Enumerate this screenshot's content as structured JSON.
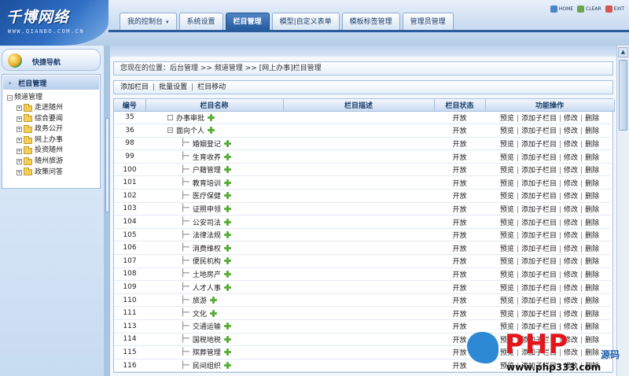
{
  "header": {
    "logo_text": "千博网络",
    "logo_sub": "WWW.QIANBO.COM.CN",
    "tabs": [
      {
        "label": "我的控制台",
        "active": false,
        "has_dropdown": true
      },
      {
        "label": "系统设置",
        "active": false
      },
      {
        "label": "栏目管理",
        "active": true
      },
      {
        "label": "模型|自定义表单",
        "active": false
      },
      {
        "label": "模板标签管理",
        "active": false
      },
      {
        "label": "管理员管理",
        "active": false
      }
    ],
    "quick_buttons": [
      {
        "label": "HOME",
        "icon": "home-icon",
        "color": "#4a86c8"
      },
      {
        "label": "CLEAR",
        "icon": "clear-icon",
        "color": "#6aa84f"
      },
      {
        "label": "EXIT",
        "icon": "exit-icon",
        "color": "#d9534f"
      }
    ]
  },
  "sidebar": {
    "title": "快捷导航",
    "section": "栏目管理",
    "root": "频道管理",
    "items": [
      "走进随州",
      "综合要闻",
      "政务公开",
      "网上办事",
      "投资随州",
      "随州旅游",
      "政策问答"
    ]
  },
  "main": {
    "breadcrumb": "您现在的位置：后台管理 >> 频道管理 >> [网上办事]栏目管理",
    "toolbar": [
      "添加栏目",
      "批量设置",
      "栏目移动"
    ],
    "columns": [
      "编号",
      "栏目名称",
      "栏目描述",
      "栏目状态",
      "功能操作"
    ],
    "ops": [
      "预览",
      "添加子栏目",
      "修改",
      "删除"
    ],
    "rows": [
      {
        "id": "35",
        "name": "办事审批",
        "level": 0,
        "expand": "□",
        "state": "开放"
      },
      {
        "id": "36",
        "name": "面向个人",
        "level": 0,
        "expand": "⊟",
        "state": "开放"
      },
      {
        "id": "98",
        "name": "婚姻登记",
        "level": 1,
        "state": "开放"
      },
      {
        "id": "99",
        "name": "生育收养",
        "level": 1,
        "state": "开放"
      },
      {
        "id": "100",
        "name": "户籍管理",
        "level": 1,
        "state": "开放"
      },
      {
        "id": "101",
        "name": "教育培训",
        "level": 1,
        "state": "开放"
      },
      {
        "id": "102",
        "name": "医疗保健",
        "level": 1,
        "state": "开放"
      },
      {
        "id": "103",
        "name": "证照申领",
        "level": 1,
        "state": "开放"
      },
      {
        "id": "104",
        "name": "公安司法",
        "level": 1,
        "state": "开放"
      },
      {
        "id": "105",
        "name": "法律法规",
        "level": 1,
        "state": "开放"
      },
      {
        "id": "106",
        "name": "消费维权",
        "level": 1,
        "state": "开放"
      },
      {
        "id": "107",
        "name": "便民机构",
        "level": 1,
        "state": "开放"
      },
      {
        "id": "108",
        "name": "土地房产",
        "level": 1,
        "state": "开放"
      },
      {
        "id": "109",
        "name": "人才人事",
        "level": 1,
        "state": "开放"
      },
      {
        "id": "110",
        "name": "旅游",
        "level": 1,
        "state": "开放"
      },
      {
        "id": "111",
        "name": "文化",
        "level": 1,
        "state": "开放"
      },
      {
        "id": "113",
        "name": "交通运输",
        "level": 1,
        "state": "开放"
      },
      {
        "id": "114",
        "name": "国税地税",
        "level": 1,
        "state": "开放"
      },
      {
        "id": "115",
        "name": "殡葬管理",
        "level": 1,
        "state": "开放"
      },
      {
        "id": "116",
        "name": "民间组织",
        "level": 1,
        "state": "开放"
      }
    ]
  },
  "watermark": {
    "brand": "PHP",
    "suffix": "源码",
    "url": "www.php333.com"
  }
}
